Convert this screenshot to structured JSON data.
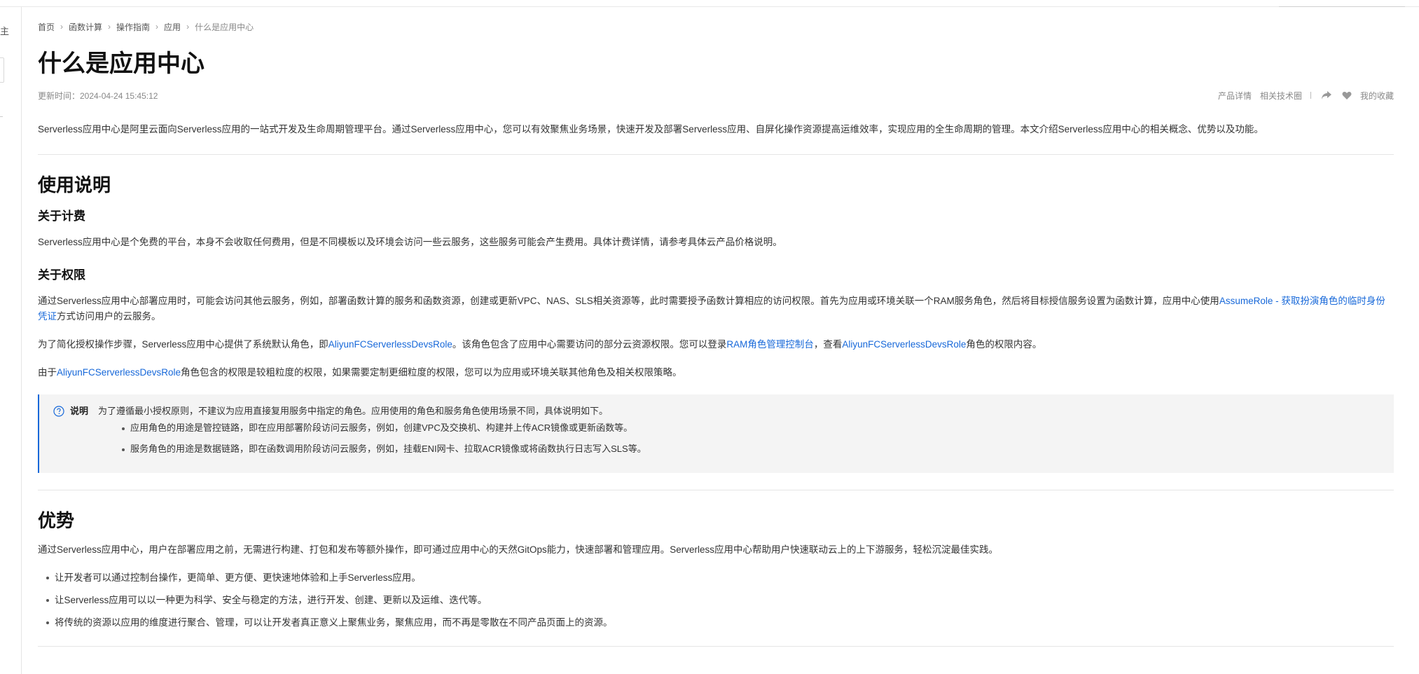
{
  "left_rail": {
    "char": "主"
  },
  "breadcrumb": [
    {
      "label": "首页"
    },
    {
      "label": "函数计算"
    },
    {
      "label": "操作指南"
    },
    {
      "label": "应用"
    },
    {
      "label": "什么是应用中心"
    }
  ],
  "page": {
    "title": "什么是应用中心",
    "update_time": "更新时间：2024-04-24 15:45:12"
  },
  "meta_links": {
    "product_detail": "产品详情",
    "related_circle": "相关技术圈",
    "share_icon": "share-icon",
    "favorite_icon": "heart-icon",
    "my_favorites": "我的收藏"
  },
  "intro": "Serverless应用中心是阿里云面向Serverless应用的一站式开发及生命周期管理平台。通过Serverless应用中心，您可以有效聚焦业务场景，快速开发及部署Serverless应用、自屏化操作资源提高运维效率，实现应用的全生命周期的管理。本文介绍Serverless应用中心的相关概念、优势以及功能。",
  "usage": {
    "heading": "使用说明",
    "billing": {
      "heading": "关于计费",
      "text": "Serverless应用中心是个免费的平台，本身不会收取任何费用，但是不同模板以及环境会访问一些云服务，这些服务可能会产生费用。具体计费详情，请参考具体云产品价格说明。"
    },
    "permissions": {
      "heading": "关于权限",
      "p1_before": "通过Serverless应用中心部署应用时，可能会访问其他云服务，例如，部署函数计算的服务和函数资源，创建或更新VPC、NAS、SLS相关资源等，此时需要授予函数计算相应的访问权限。首先为应用或环境关联一个RAM服务角色，然后将目标授信服务设置为函数计算，应用中心使用",
      "p1_link": "AssumeRole - 获取扮演角色的临时身份凭证",
      "p1_after": "方式访问用户的云服务。",
      "p2_before": "为了简化授权操作步骤，Serverless应用中心提供了系统默认角色，即",
      "p2_link1": "AliyunFCServerlessDevsRole",
      "p2_mid1": "。该角色包含了应用中心需要访问的部分云资源权限。您可以登录",
      "p2_link2": "RAM角色管理控制台",
      "p2_mid2": "，查看",
      "p2_link3": "AliyunFCServerlessDevsRole",
      "p2_after": "角色的权限内容。",
      "p3_before": "由于",
      "p3_link": "AliyunFCServerlessDevsRole",
      "p3_after": "角色包含的权限是较粗粒度的权限，如果需要定制更细粒度的权限，您可以为应用或环境关联其他角色及相关权限策略。"
    },
    "note": {
      "icon": "question-circle-icon",
      "label": "说明",
      "text": "为了遵循最小授权原则，不建议为应用直接复用服务中指定的角色。应用使用的角色和服务角色使用场景不同，具体说明如下。",
      "items": [
        "应用角色的用途是管控链路，即在应用部署阶段访问云服务，例如，创建VPC及交换机、构建并上传ACR镜像或更新函数等。",
        "服务角色的用途是数据链路，即在函数调用阶段访问云服务，例如，挂载ENI网卡、拉取ACR镜像或将函数执行日志写入SLS等。"
      ]
    }
  },
  "advantages": {
    "heading": "优势",
    "intro": "通过Serverless应用中心，用户在部署应用之前，无需进行构建、打包和发布等额外操作，即可通过应用中心的天然GitOps能力，快速部署和管理应用。Serverless应用中心帮助用户快速联动云上的上下游服务，轻松沉淀最佳实践。",
    "items": [
      "让开发者可以通过控制台操作，更简单、更方便、更快速地体验和上手Serverless应用。",
      "让Serverless应用可以以一种更为科学、安全与稳定的方法，进行开发、创建、更新以及运维、迭代等。",
      "将传统的资源以应用的维度进行聚合、管理，可以让开发者真正意义上聚焦业务，聚焦应用，而不再是零散在不同产品页面上的资源。"
    ]
  },
  "colors": {
    "link": "#1768d9",
    "note_bar": "#1768d9",
    "note_bg": "#f4f4f4"
  }
}
